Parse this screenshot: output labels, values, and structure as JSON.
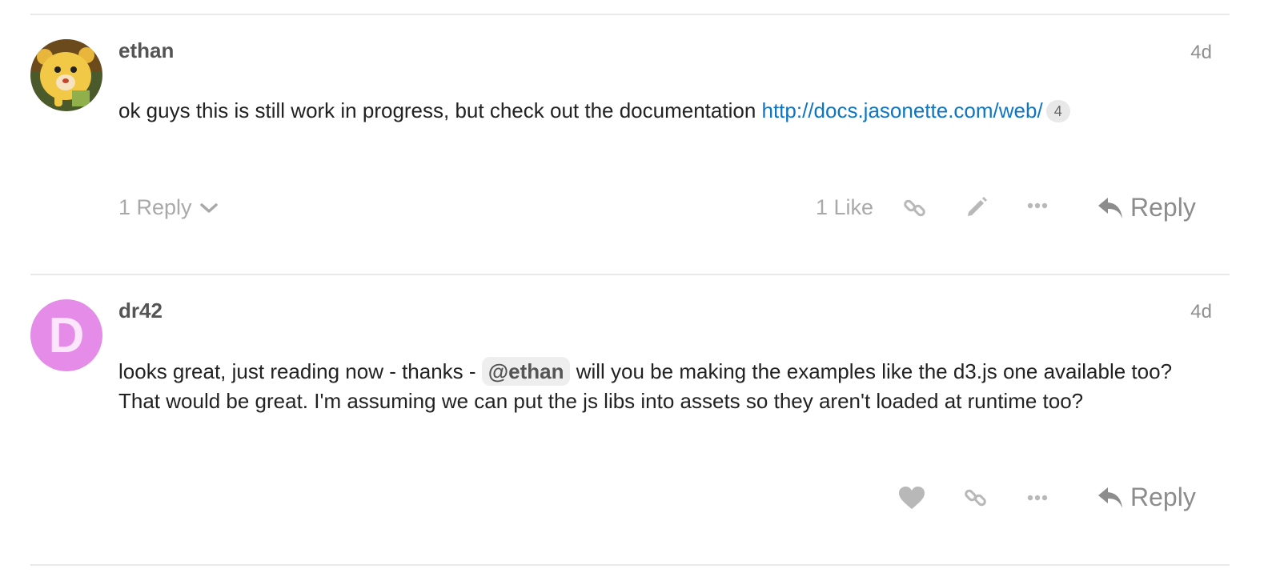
{
  "posts": [
    {
      "username": "ethan",
      "age": "4d",
      "text": "ok guys this is still work in progress, but check out the documentation ",
      "link_text": "http://docs.jasonette.com/web/",
      "link_clicks": "4",
      "replies_label": "1 Reply",
      "likes_label": "1 Like",
      "reply_label": "Reply",
      "icons": [
        "avatar-bear",
        "chevron-down-icon",
        "link-icon",
        "pencil-icon",
        "more-icon",
        "reply-arrow-icon"
      ]
    },
    {
      "username": "dr42",
      "avatar_letter": "D",
      "avatar_color": "#e48ce8",
      "age": "4d",
      "text_before": "looks great, just reading now - thanks - ",
      "mention": "@ethan",
      "text_after": " will you be making the examples like the d3.js one available too? That would be great. I'm assuming we can put the js libs into assets so they aren't loaded at runtime too?",
      "reply_label": "Reply",
      "icons": [
        "heart-icon",
        "link-icon",
        "more-icon",
        "reply-arrow-icon"
      ]
    }
  ],
  "colors": {
    "link": "#0e75c4",
    "muted": "#a9a9a9",
    "divider": "#e9e9e9"
  }
}
